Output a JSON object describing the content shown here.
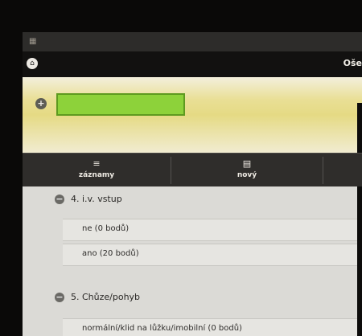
{
  "header": {
    "system_icon": "app-grid-icon",
    "nav_title": "Oše",
    "home_icon": "home-icon"
  },
  "patient": {
    "expand_icon": "plus-icon",
    "highlight_color": "#8dd23a"
  },
  "toolbar": {
    "items": [
      {
        "label": "záznamy",
        "icon": "list-icon"
      },
      {
        "label": "nový",
        "icon": "document-icon"
      }
    ]
  },
  "sections": [
    {
      "title": "4. i.v. vstup",
      "options": [
        "ne (0 bodů)",
        "ano (20 bodů)"
      ]
    },
    {
      "title": "5. Chůze/pohyb",
      "options": [
        "normální/klid na lůžku/imobilní (0 bodů)"
      ]
    }
  ]
}
